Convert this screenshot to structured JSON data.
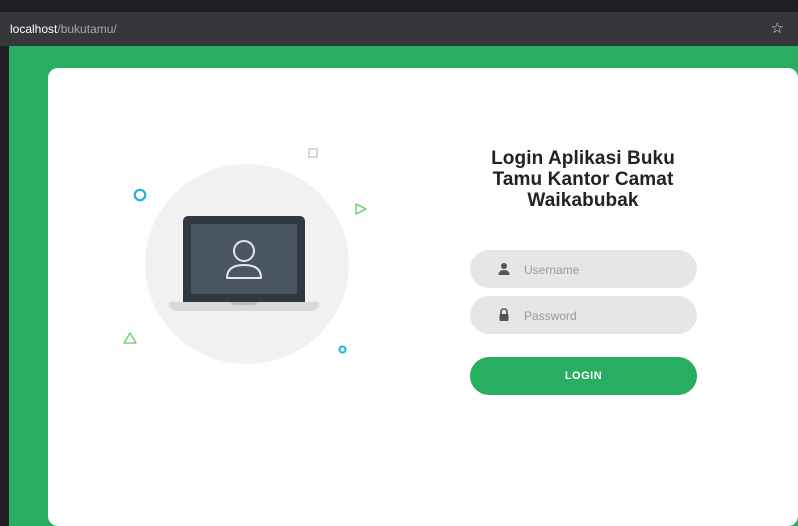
{
  "browser": {
    "url_host": "localhost",
    "url_path": "/bukutamu/",
    "bookmark_icon": "star-icon"
  },
  "login": {
    "title": "Login Aplikasi Buku Tamu Kantor Camat Waikabubak",
    "username_placeholder": "Username",
    "password_placeholder": "Password",
    "button_label": "LOGIN"
  },
  "illustration": {
    "icon": "user-icon",
    "device": "laptop-icon"
  },
  "colors": {
    "accent": "#27ae60",
    "card": "#ffffff",
    "input_bg": "#e6e6e6",
    "browser_bar": "#35373b"
  }
}
